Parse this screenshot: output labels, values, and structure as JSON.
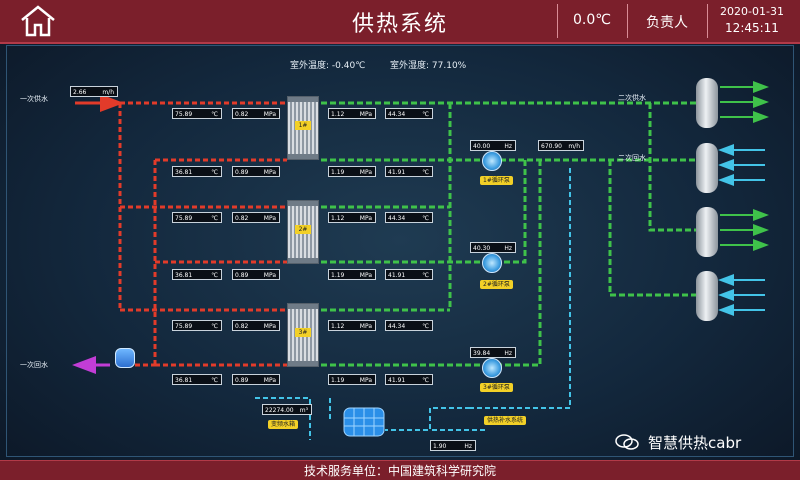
{
  "header": {
    "title": "供热系统",
    "temperature": "0.0℃",
    "person": "负责人",
    "date": "2020-01-31",
    "time": "12:45:11"
  },
  "outdoor": {
    "temp_label": "室外温度:",
    "temp_value": "-0.40℃",
    "humidity_label": "室外湿度:",
    "humidity_value": "77.10%"
  },
  "labels": {
    "primary_supply": "一次供水",
    "primary_return": "一次回水",
    "secondary_supply": "二次供水",
    "secondary_return": "二次回水"
  },
  "flow_primary": {
    "value": "2.66",
    "unit": "m/h"
  },
  "flow_secondary": {
    "value": "670.90",
    "unit": "m/h"
  },
  "units": {
    "temp": "℃",
    "pressure": "MPa",
    "freq": "Hz",
    "vol": "m³"
  },
  "exchangers": [
    {
      "name": "1#",
      "in_supply": {
        "temp": "75.89",
        "press": "0.82"
      },
      "in_return": {
        "temp": "36.81",
        "press": "0.89"
      },
      "out_supply": {
        "press": "1.12",
        "temp": "44.34"
      },
      "out_return": {
        "press": "1.19",
        "temp": "41.91"
      },
      "pump": {
        "freq": "40.00",
        "tag": "1#循环泵"
      }
    },
    {
      "name": "2#",
      "in_supply": {
        "temp": "75.89",
        "press": "0.82"
      },
      "in_return": {
        "temp": "36.81",
        "press": "0.89"
      },
      "out_supply": {
        "press": "1.12",
        "temp": "44.34"
      },
      "out_return": {
        "press": "1.19",
        "temp": "41.91"
      },
      "pump": {
        "freq": "40.30",
        "tag": "2#循环泵"
      }
    },
    {
      "name": "3#",
      "in_supply": {
        "temp": "75.89",
        "press": "0.82"
      },
      "in_return": {
        "temp": "36.81",
        "press": "0.89"
      },
      "out_supply": {
        "press": "1.12",
        "temp": "44.34"
      },
      "out_return": {
        "press": "1.19",
        "temp": "41.91"
      },
      "pump": {
        "freq": "39.84",
        "tag": "3#循环泵"
      }
    }
  ],
  "water_tank": {
    "volume": "22274.00",
    "tag": "变频水箱"
  },
  "makeup": {
    "value": "1.90",
    "unit": "Hz",
    "tag": "供热补水系统"
  },
  "footer": "技术服务单位：中国建筑科学研究院",
  "watermark": "智慧供热cabr",
  "colors": {
    "header": "#7b1f2b",
    "supply_hot": "#e23b2a",
    "secondary": "#3fc24a",
    "return_cold": "#43c4e8",
    "accent": "#f2d027"
  }
}
